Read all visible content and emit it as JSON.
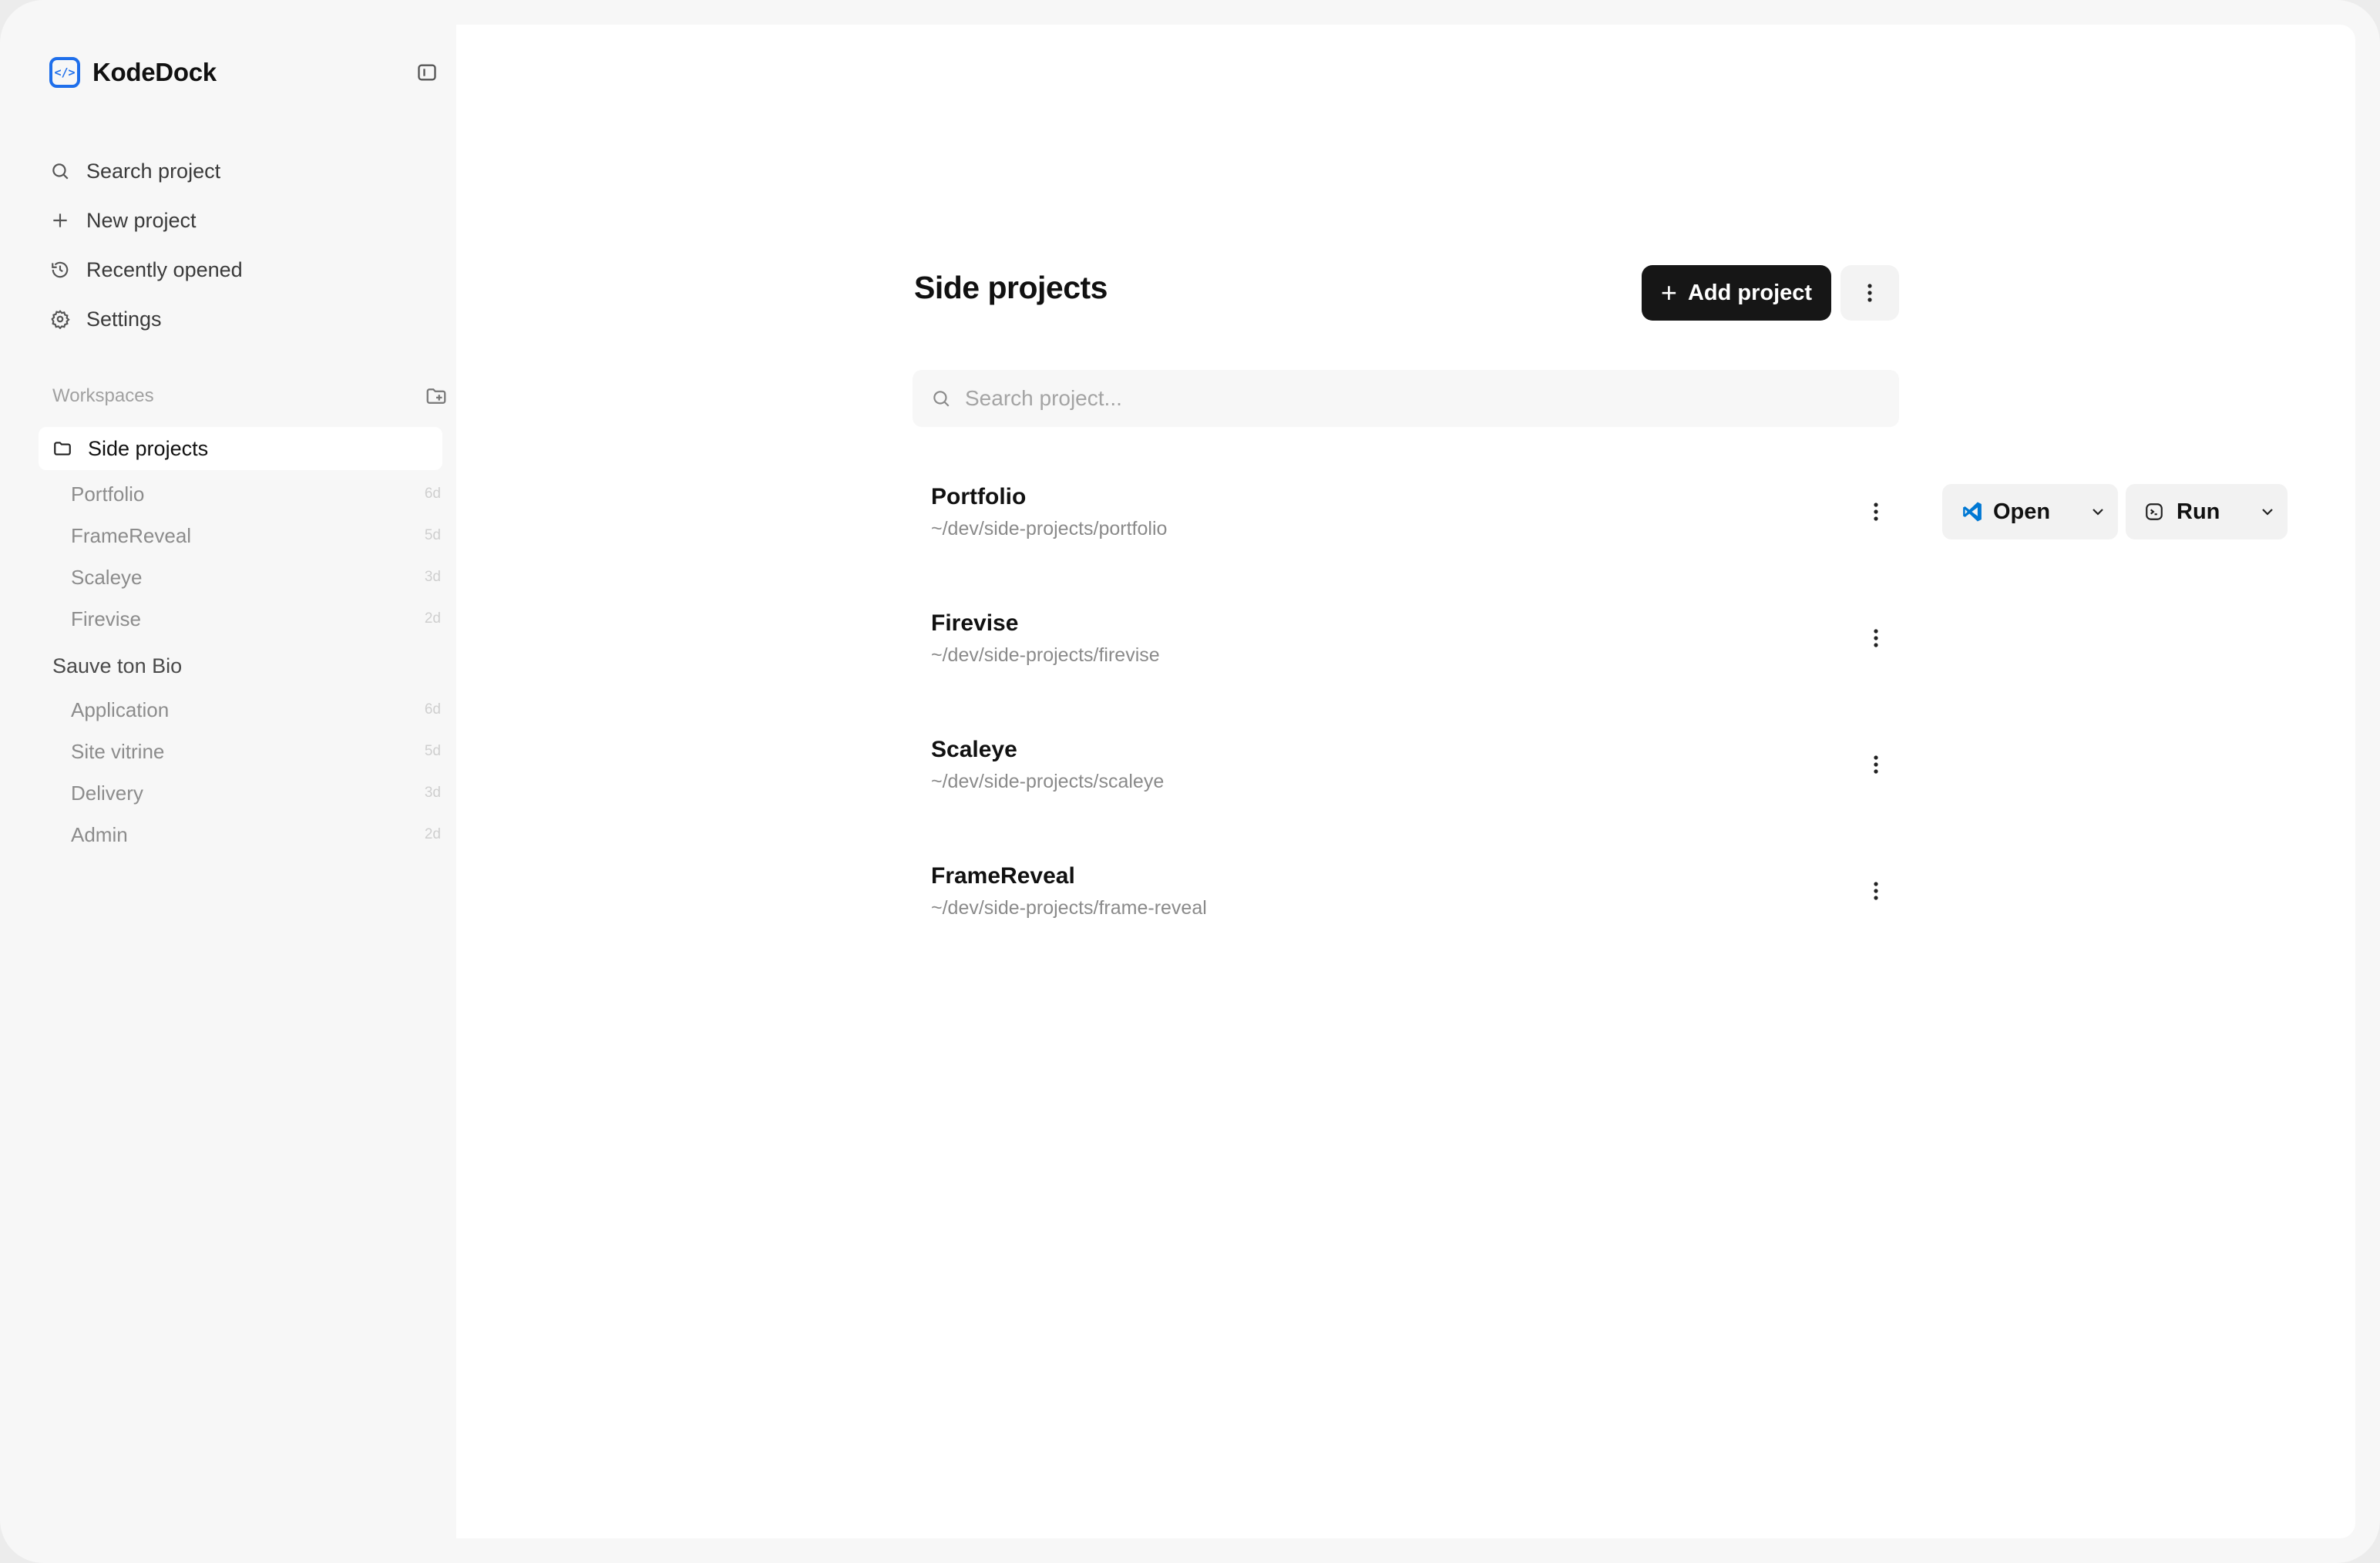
{
  "app": {
    "name": "KodeDock"
  },
  "sidebar": {
    "nav": [
      {
        "label": "Search project",
        "icon": "search-icon"
      },
      {
        "label": "New project",
        "icon": "plus-icon"
      },
      {
        "label": "Recently opened",
        "icon": "history-icon"
      },
      {
        "label": "Settings",
        "icon": "gear-icon"
      }
    ],
    "workspaces_label": "Workspaces",
    "workspaces": [
      {
        "name": "Side projects",
        "active": true,
        "items": [
          {
            "name": "Portfolio",
            "age": "6d"
          },
          {
            "name": "FrameReveal",
            "age": "5d"
          },
          {
            "name": "Scaleye",
            "age": "3d"
          },
          {
            "name": "Firevise",
            "age": "2d"
          }
        ]
      },
      {
        "name": "Sauve ton Bio",
        "active": false,
        "items": [
          {
            "name": "Application",
            "age": "6d"
          },
          {
            "name": "Site vitrine",
            "age": "5d"
          },
          {
            "name": "Delivery",
            "age": "3d"
          },
          {
            "name": "Admin",
            "age": "2d"
          }
        ]
      }
    ]
  },
  "main": {
    "title": "Side projects",
    "add_button": "Add project",
    "search_placeholder": "Search project...",
    "projects": [
      {
        "name": "Portfolio",
        "path": "~/dev/side-projects/portfolio",
        "open_label": "Open",
        "run_label": "Run"
      },
      {
        "name": "Firevise",
        "path": "~/dev/side-projects/firevise"
      },
      {
        "name": "Scaleye",
        "path": "~/dev/side-projects/scaleye"
      },
      {
        "name": "FrameReveal",
        "path": "~/dev/side-projects/frame-reveal"
      }
    ]
  },
  "colors": {
    "accent": "#1f6feb",
    "primary_button": "#161616",
    "vscode_blue": "#0078d4"
  }
}
